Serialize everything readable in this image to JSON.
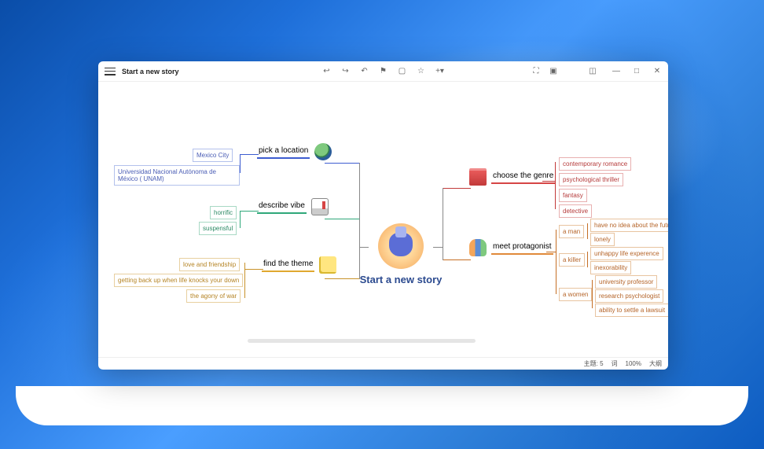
{
  "window": {
    "title": "Start a new story"
  },
  "mindmap": {
    "central": "Start a new story",
    "branches": {
      "location": {
        "label": "pick a location",
        "children": [
          "Mexico City",
          "Universidad Nacional Autónoma de México ( UNAM)"
        ]
      },
      "vibe": {
        "label": "describe vibe",
        "children": [
          "horrific",
          "suspensful"
        ]
      },
      "theme": {
        "label": "find the theme",
        "children": [
          "love and friendship",
          "getting back up when life knocks your down",
          "the agony of war"
        ]
      },
      "genre": {
        "label": "choose the genre",
        "children": [
          "contemporary romance",
          "psychological thriller",
          "fantasy",
          "detective"
        ]
      },
      "protagonist": {
        "label": "meet protagonist",
        "groups": [
          {
            "label": "a man",
            "children": [
              "have no idea about the future",
              "lonely"
            ]
          },
          {
            "label": "a killer",
            "children": [
              "unhappy life experence",
              "inexorability"
            ]
          },
          {
            "label": "a women",
            "children": [
              "university professor",
              "research psychologist",
              "ability to settle a lawsuit"
            ]
          }
        ]
      }
    }
  },
  "status": {
    "topic": "主题: 5",
    "words_icon": "词",
    "zoom": "100%",
    "outline": "大纲"
  }
}
